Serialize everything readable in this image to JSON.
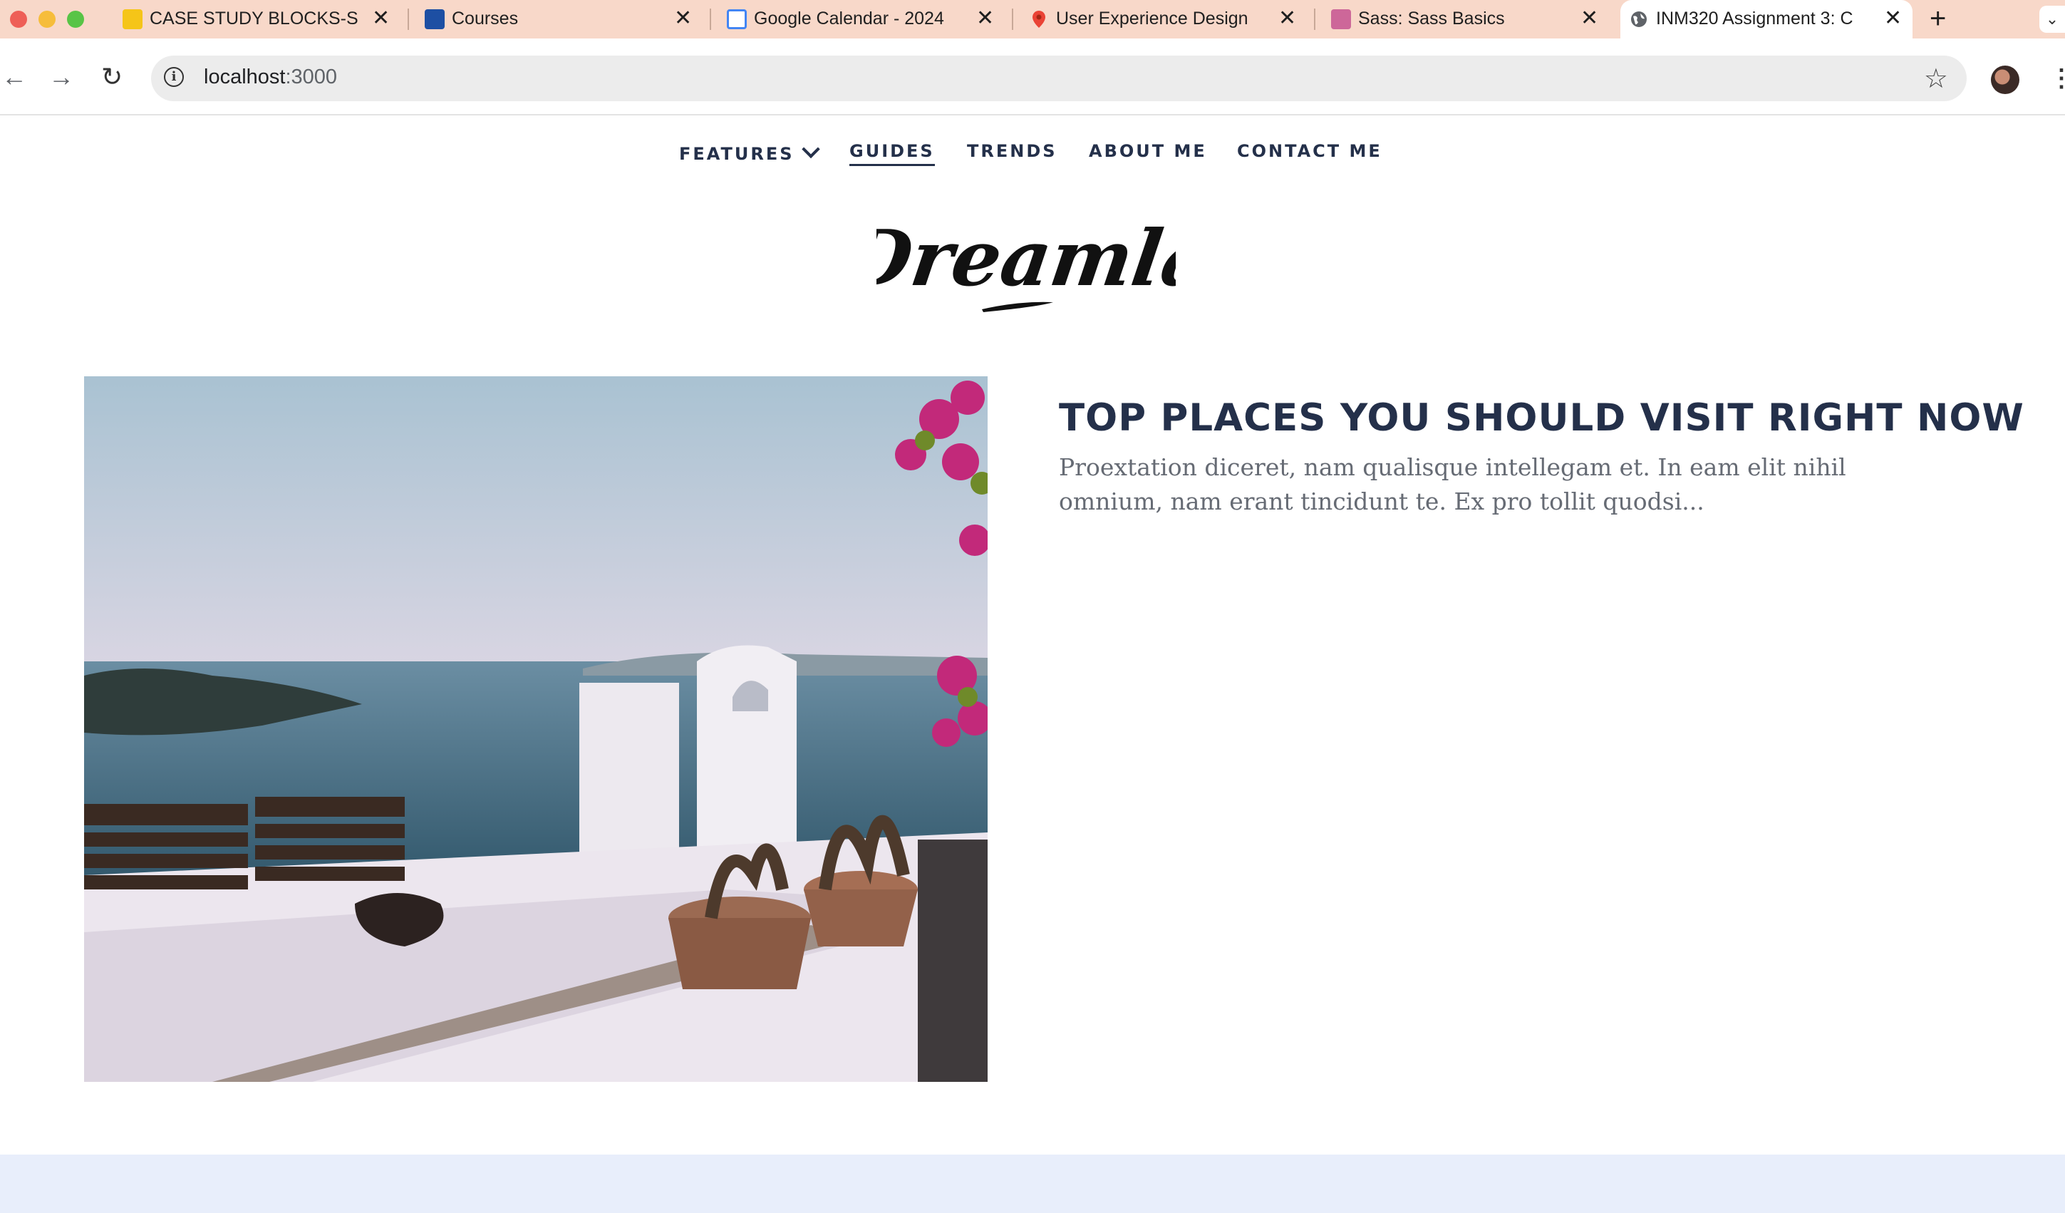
{
  "browser": {
    "tabs": [
      {
        "title": "CASE STUDY BLOCKS-S",
        "icon": "miro-icon",
        "active": false
      },
      {
        "title": "Courses",
        "icon": "canvas-icon",
        "active": false
      },
      {
        "title": "Google Calendar - 2024",
        "icon": "calendar-icon",
        "active": false
      },
      {
        "title": "User Experience Design",
        "icon": "map-pin-icon",
        "active": false
      },
      {
        "title": "Sass: Sass Basics",
        "icon": "sass-icon",
        "active": false
      },
      {
        "title": "INM320 Assignment 3: C",
        "icon": "globe-icon",
        "active": true
      }
    ],
    "new_tab": "+",
    "url_host": "localhost",
    "url_port": ":3000"
  },
  "site": {
    "nav": [
      {
        "label": "FEATURES",
        "has_dropdown": true
      },
      {
        "label": "GUIDES",
        "active": true
      },
      {
        "label": "TRENDS"
      },
      {
        "label": "ABOUT ME"
      },
      {
        "label": "CONTACT ME"
      }
    ],
    "logo_text": "Dreamla",
    "post": {
      "title": "TOP PLACES YOU SHOULD VISIT RIGHT NOW",
      "excerpt": "Proextation diceret, nam qualisque intellegam et. In eam elit nihil omnium, nam erant tincidunt te. Ex pro tollit quodsi..."
    }
  },
  "colors": {
    "tabbar": "#f8d8c9",
    "nav_text": "#24304a",
    "excerpt": "#666b74",
    "footer_band": "#e8eefb"
  }
}
